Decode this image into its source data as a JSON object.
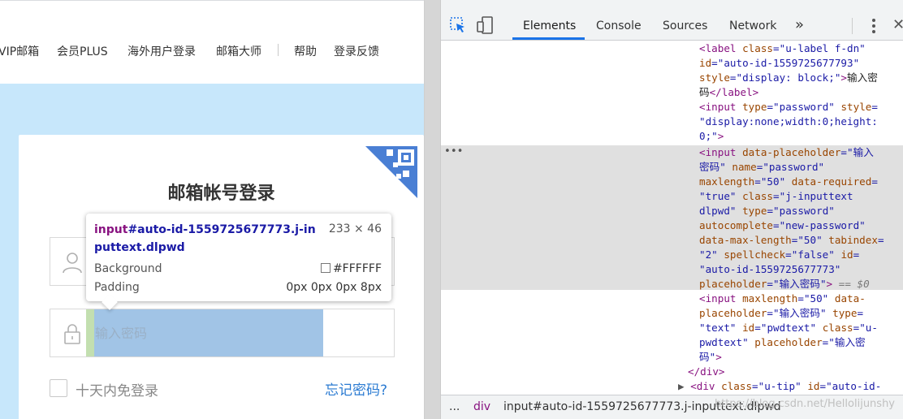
{
  "page": {
    "nav_items": [
      "VIP邮箱",
      "会员PLUS",
      "海外用户登录",
      "邮箱大师",
      "帮助",
      "登录反馈"
    ],
    "card_title": "邮箱帐号登录",
    "password_placeholder": "输入密码",
    "remember_label": "十天内免登录",
    "forgot_link": "忘记密码?"
  },
  "tooltip": {
    "tag": "input",
    "selector": "#auto-id-1559725677773.j-inputtext.dlpwd",
    "size": "233 × 46",
    "rows": [
      {
        "label": "Background",
        "value": "#FFFFFF"
      },
      {
        "label": "Padding",
        "value": "0px 0px 0px 8px"
      }
    ]
  },
  "devtools": {
    "tabs": [
      "Elements",
      "Console",
      "Sources",
      "Network"
    ],
    "active_tab": "Elements",
    "more": "»",
    "breadcrumb": [
      "...",
      "div",
      "input#auto-id-1559725677773.j-inputtext.dlpwd"
    ],
    "watermark": "https://blog.csdn.net/Hellolijunshy"
  },
  "colors": {
    "accent": "#1a73e8",
    "page_bg": "#c7e7fb",
    "highlight": "#a1c4e6",
    "padding_highlight": "#c3dfb0",
    "link": "#2b7bd2"
  },
  "icons": [
    "inspect-element-icon",
    "device-toolbar-icon",
    "user-icon",
    "lock-icon",
    "qr-code-icon",
    "more-vert-icon",
    "close-icon"
  ]
}
